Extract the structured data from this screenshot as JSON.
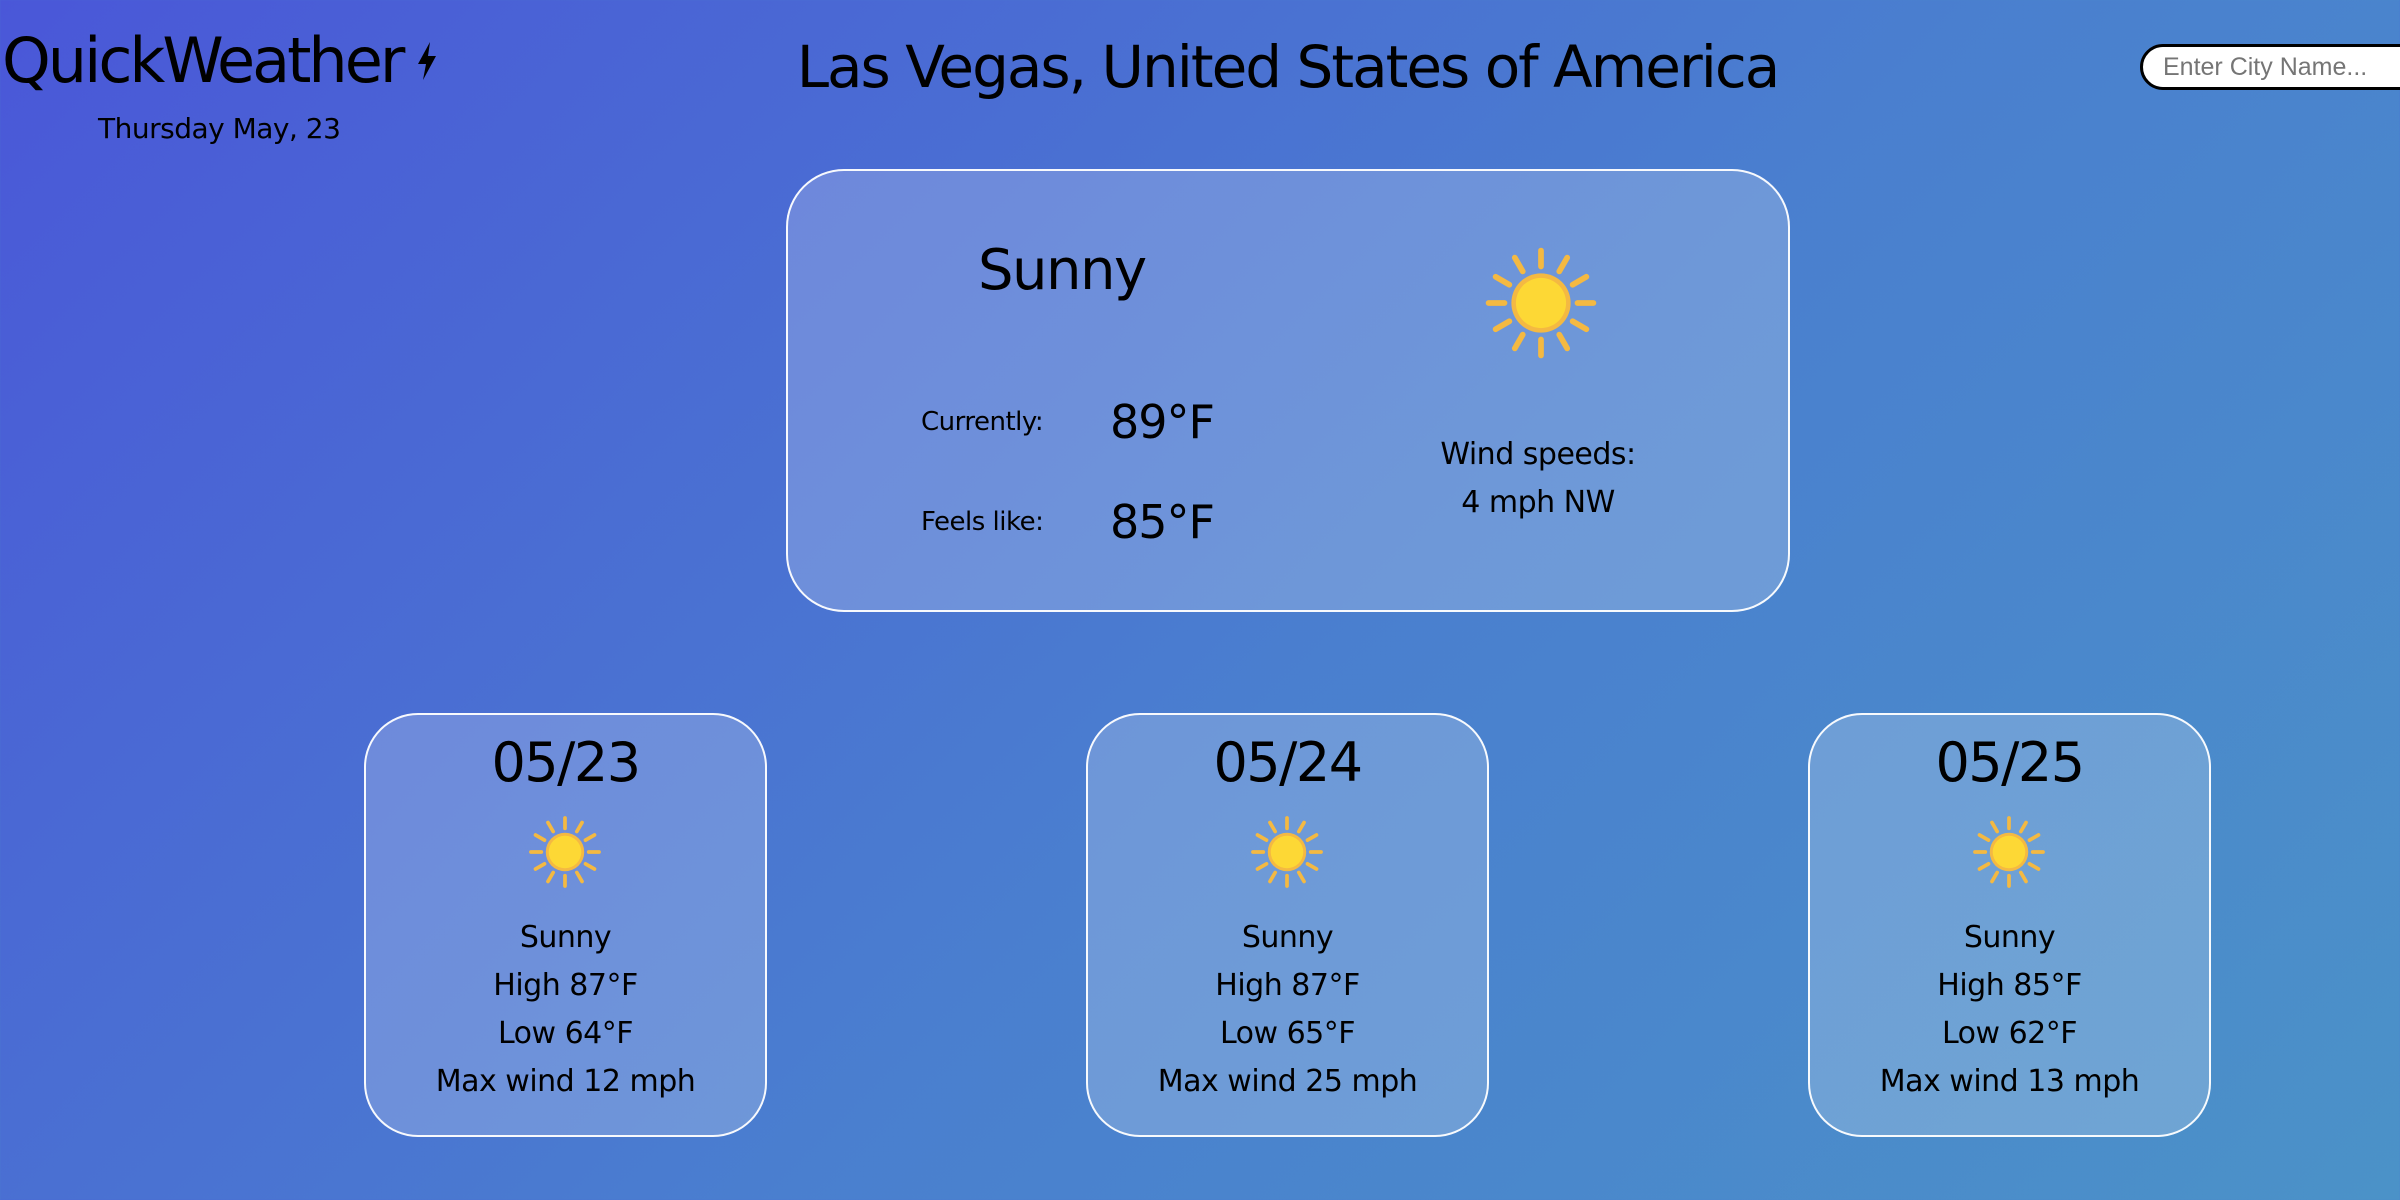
{
  "header": {
    "app_name": "QuickWeather",
    "logo_icon": "lightning-bolt-icon",
    "date": "Thursday May, 23",
    "location": "Las Vegas, United States of America"
  },
  "search": {
    "placeholder": "Enter City Name...",
    "value": ""
  },
  "current": {
    "condition": "Sunny",
    "icon": "sun-icon",
    "currently_label": "Currently:",
    "currently_value": "89°F",
    "feels_label": "Feels like:",
    "feels_value": "85°F",
    "wind_label": "Wind speeds:",
    "wind_value": "4 mph NW"
  },
  "forecast": [
    {
      "date": "05/23",
      "icon": "sun-icon",
      "condition": "Sunny",
      "high": "High 87°F",
      "low": "Low 64°F",
      "wind": "Max wind 12 mph"
    },
    {
      "date": "05/24",
      "icon": "sun-icon",
      "condition": "Sunny",
      "high": "High 87°F",
      "low": "Low 65°F",
      "wind": "Max wind 25 mph"
    },
    {
      "date": "05/25",
      "icon": "sun-icon",
      "condition": "Sunny",
      "high": "High 85°F",
      "low": "Low 62°F",
      "wind": "Max wind 13 mph"
    }
  ],
  "colors": {
    "background_start": "#4a57d8",
    "background_end": "#4b92c8",
    "card_border": "#ffffff",
    "sun_core": "#fdd835",
    "sun_rays": "#f4b942"
  }
}
